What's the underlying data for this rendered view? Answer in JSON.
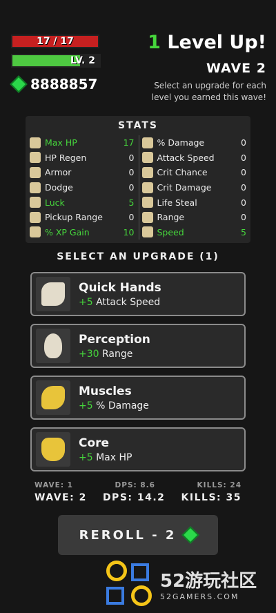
{
  "hud": {
    "hp_text": "17 / 17",
    "level_text": "LV. 2",
    "level_fill": 0.78,
    "gems_text": "8888857"
  },
  "header": {
    "levelup_count": "1",
    "levelup_label": "Level Up!",
    "wave": "WAVE 2",
    "subtitle": "Select an upgrade for each level you earned this wave!"
  },
  "stats": {
    "title": "STATS",
    "left": [
      {
        "label": "Max HP",
        "value": "17",
        "highlight": true
      },
      {
        "label": "HP Regen",
        "value": "0"
      },
      {
        "label": "Armor",
        "value": "0"
      },
      {
        "label": "Dodge",
        "value": "0"
      },
      {
        "label": "Luck",
        "value": "5",
        "highlight": true
      },
      {
        "label": "Pickup Range",
        "value": "0"
      },
      {
        "label": "% XP Gain",
        "value": "10",
        "highlight": true
      }
    ],
    "right": [
      {
        "label": "% Damage",
        "value": "0"
      },
      {
        "label": "Attack Speed",
        "value": "0"
      },
      {
        "label": "Crit Chance",
        "value": "0"
      },
      {
        "label": "Crit Damage",
        "value": "0"
      },
      {
        "label": "Life Steal",
        "value": "0"
      },
      {
        "label": "Range",
        "value": "0"
      },
      {
        "label": "Speed",
        "value": "5",
        "highlight": true
      }
    ]
  },
  "select_header": "SELECT AN UPGRADE (1)",
  "upgrades": [
    {
      "name": "Quick Hands",
      "bonus": "+5",
      "stat": "Attack Speed",
      "icon": "hand-icon"
    },
    {
      "name": "Perception",
      "bonus": "+30",
      "stat": "Range",
      "icon": "head-icon"
    },
    {
      "name": "Muscles",
      "bonus": "+5",
      "stat": "% Damage",
      "icon": "bicep-icon"
    },
    {
      "name": "Core",
      "bonus": "+5",
      "stat": "Max HP",
      "icon": "torso-icon"
    }
  ],
  "footer": {
    "prev": {
      "wave": "WAVE: 1",
      "dps": "DPS: 8.6",
      "kills": "KILLS: 24"
    },
    "curr": {
      "wave": "WAVE: 2",
      "dps": "DPS: 14.2",
      "kills": "KILLS: 35"
    }
  },
  "reroll_label": "REROLL - 2",
  "watermark": {
    "big": "52游玩社区",
    "small": "52GAMERS.COM"
  },
  "colors": {
    "accent_green": "#46d63c",
    "hp_red": "#c62020"
  }
}
